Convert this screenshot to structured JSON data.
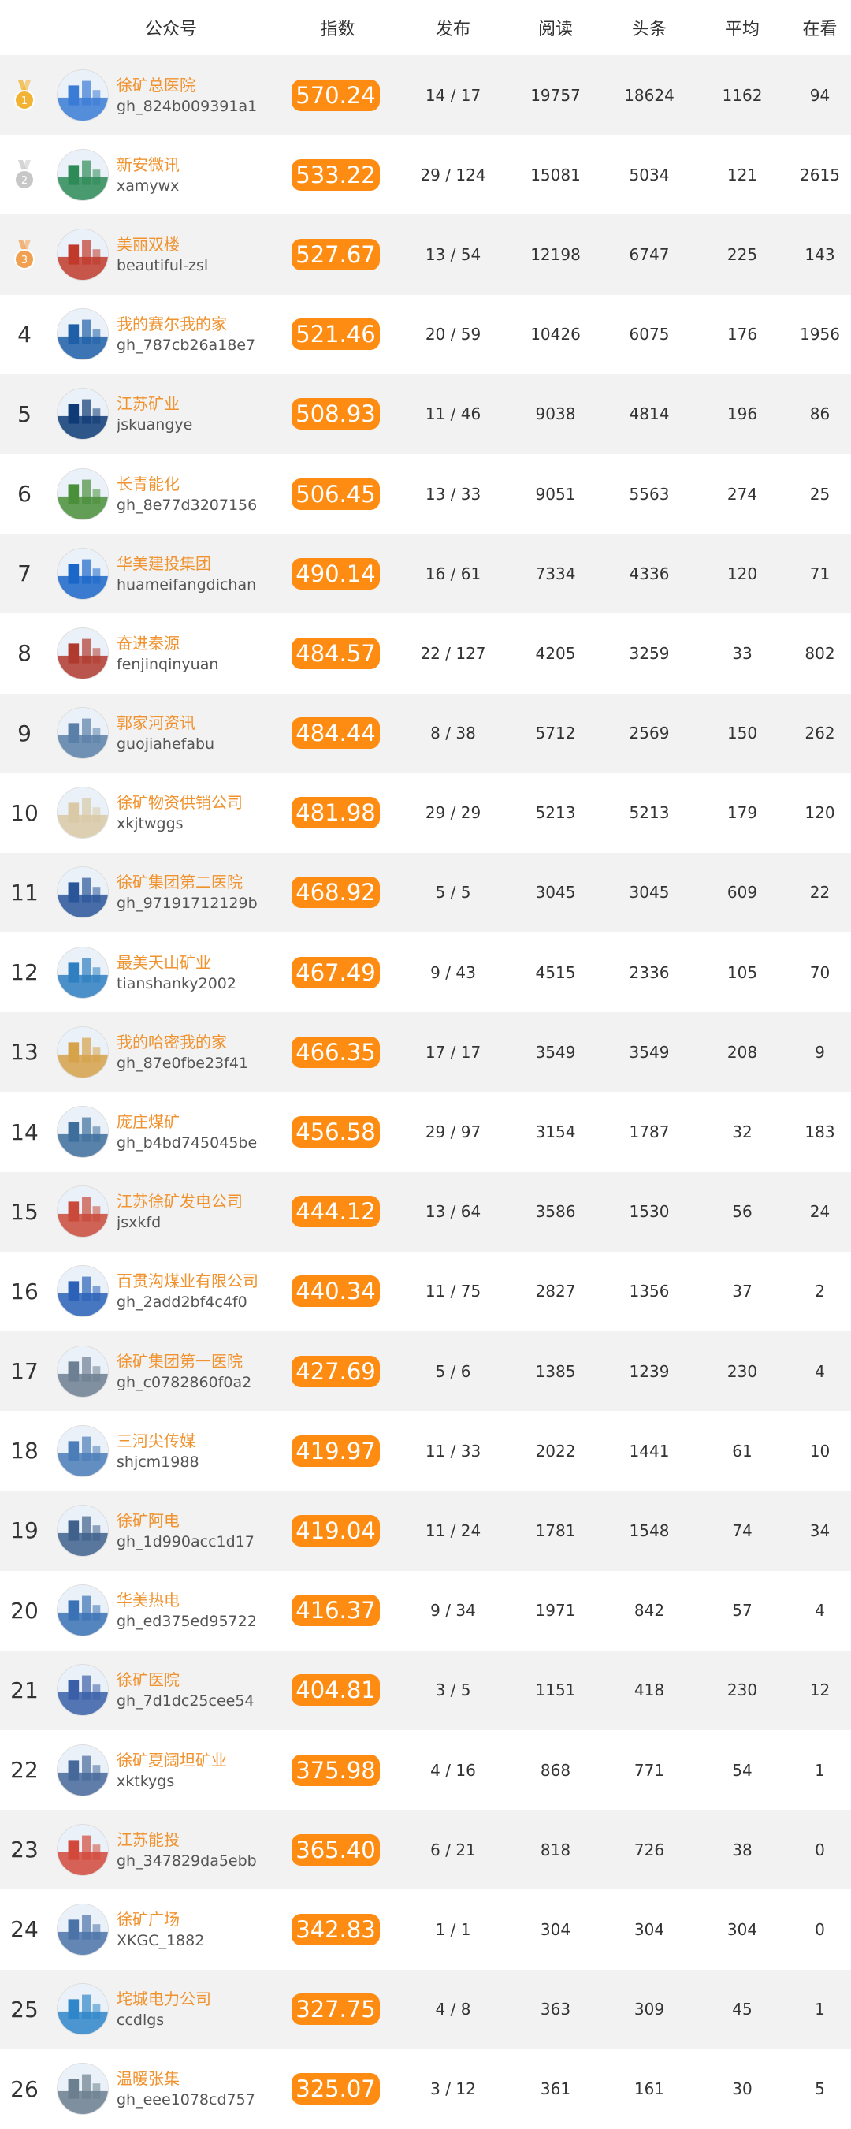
{
  "header": {
    "account": "公众号",
    "index": "指数",
    "publish": "发布",
    "read": "阅读",
    "headline": "头条",
    "average": "平均",
    "watching": "在看"
  },
  "colors": {
    "accent": "#ff8c12",
    "name_text": "#f0922e",
    "gold": "#f2b233",
    "silver": "#c7c7c7",
    "bronze": "#f0a050",
    "row_alt": "#f2f2f2"
  },
  "rows": [
    {
      "rank": "1",
      "medal": "gold",
      "name": "徐矿总医院",
      "id": "gh_824b009391a1",
      "score": "570.24",
      "publish": "14 / 17",
      "read": "19757",
      "headline": "18624",
      "average": "1162",
      "watching": "94"
    },
    {
      "rank": "2",
      "medal": "silver",
      "name": "新安微讯",
      "id": "xamywx",
      "score": "533.22",
      "publish": "29 / 124",
      "read": "15081",
      "headline": "5034",
      "average": "121",
      "watching": "2615"
    },
    {
      "rank": "3",
      "medal": "bronze",
      "name": "美丽双楼",
      "id": "beautiful-zsl",
      "score": "527.67",
      "publish": "13 / 54",
      "read": "12198",
      "headline": "6747",
      "average": "225",
      "watching": "143"
    },
    {
      "rank": "4",
      "name": "我的赛尔我的家",
      "id": "gh_787cb26a18e7",
      "score": "521.46",
      "publish": "20 / 59",
      "read": "10426",
      "headline": "6075",
      "average": "176",
      "watching": "1956"
    },
    {
      "rank": "5",
      "name": "江苏矿业",
      "id": "jskuangye",
      "score": "508.93",
      "publish": "11 / 46",
      "read": "9038",
      "headline": "4814",
      "average": "196",
      "watching": "86"
    },
    {
      "rank": "6",
      "name": "长青能化",
      "id": "gh_8e77d3207156",
      "score": "506.45",
      "publish": "13 / 33",
      "read": "9051",
      "headline": "5563",
      "average": "274",
      "watching": "25"
    },
    {
      "rank": "7",
      "name": "华美建投集团",
      "id": "huameifangdichan",
      "score": "490.14",
      "publish": "16 / 61",
      "read": "7334",
      "headline": "4336",
      "average": "120",
      "watching": "71"
    },
    {
      "rank": "8",
      "name": "奋进秦源",
      "id": "fenjinqinyuan",
      "score": "484.57",
      "publish": "22 / 127",
      "read": "4205",
      "headline": "3259",
      "average": "33",
      "watching": "802"
    },
    {
      "rank": "9",
      "name": "郭家河资讯",
      "id": "guojiahefabu",
      "score": "484.44",
      "publish": "8 / 38",
      "read": "5712",
      "headline": "2569",
      "average": "150",
      "watching": "262"
    },
    {
      "rank": "10",
      "name": "徐矿物资供销公司",
      "id": "xkjtwggs",
      "score": "481.98",
      "publish": "29 / 29",
      "read": "5213",
      "headline": "5213",
      "average": "179",
      "watching": "120"
    },
    {
      "rank": "11",
      "name": "徐矿集团第二医院",
      "id": "gh_97191712129b",
      "score": "468.92",
      "publish": "5 / 5",
      "read": "3045",
      "headline": "3045",
      "average": "609",
      "watching": "22"
    },
    {
      "rank": "12",
      "name": "最美天山矿业",
      "id": "tianshanky2002",
      "score": "467.49",
      "publish": "9 / 43",
      "read": "4515",
      "headline": "2336",
      "average": "105",
      "watching": "70"
    },
    {
      "rank": "13",
      "name": "我的哈密我的家",
      "id": "gh_87e0fbe23f41",
      "score": "466.35",
      "publish": "17 / 17",
      "read": "3549",
      "headline": "3549",
      "average": "208",
      "watching": "9"
    },
    {
      "rank": "14",
      "name": "庞庄煤矿",
      "id": "gh_b4bd745045be",
      "score": "456.58",
      "publish": "29 / 97",
      "read": "3154",
      "headline": "1787",
      "average": "32",
      "watching": "183"
    },
    {
      "rank": "15",
      "name": "江苏徐矿发电公司",
      "id": "jsxkfd",
      "score": "444.12",
      "publish": "13 / 64",
      "read": "3586",
      "headline": "1530",
      "average": "56",
      "watching": "24"
    },
    {
      "rank": "16",
      "name": "百贯沟煤业有限公司",
      "id": "gh_2add2bf4c4f0",
      "score": "440.34",
      "publish": "11 / 75",
      "read": "2827",
      "headline": "1356",
      "average": "37",
      "watching": "2"
    },
    {
      "rank": "17",
      "name": "徐矿集团第一医院",
      "id": "gh_c0782860f0a2",
      "score": "427.69",
      "publish": "5 / 6",
      "read": "1385",
      "headline": "1239",
      "average": "230",
      "watching": "4"
    },
    {
      "rank": "18",
      "name": "三河尖传媒",
      "id": "shjcm1988",
      "score": "419.97",
      "publish": "11 / 33",
      "read": "2022",
      "headline": "1441",
      "average": "61",
      "watching": "10"
    },
    {
      "rank": "19",
      "name": "徐矿阿电",
      "id": "gh_1d990acc1d17",
      "score": "419.04",
      "publish": "11 / 24",
      "read": "1781",
      "headline": "1548",
      "average": "74",
      "watching": "34"
    },
    {
      "rank": "20",
      "name": "华美热电",
      "id": "gh_ed375ed95722",
      "score": "416.37",
      "publish": "9 / 34",
      "read": "1971",
      "headline": "842",
      "average": "57",
      "watching": "4"
    },
    {
      "rank": "21",
      "name": "徐矿医院",
      "id": "gh_7d1dc25cee54",
      "score": "404.81",
      "publish": "3 / 5",
      "read": "1151",
      "headline": "418",
      "average": "230",
      "watching": "12"
    },
    {
      "rank": "22",
      "name": "徐矿夏阔坦矿业",
      "id": "xktkygs",
      "score": "375.98",
      "publish": "4 / 16",
      "read": "868",
      "headline": "771",
      "average": "54",
      "watching": "1"
    },
    {
      "rank": "23",
      "name": "江苏能投",
      "id": "gh_347829da5ebb",
      "score": "365.40",
      "publish": "6 / 21",
      "read": "818",
      "headline": "726",
      "average": "38",
      "watching": "0"
    },
    {
      "rank": "24",
      "name": "徐矿广场",
      "id": "XKGC_1882",
      "score": "342.83",
      "publish": "1 / 1",
      "read": "304",
      "headline": "304",
      "average": "304",
      "watching": "0"
    },
    {
      "rank": "25",
      "name": "垞城电力公司",
      "id": "ccdlgs",
      "score": "327.75",
      "publish": "4 / 8",
      "read": "363",
      "headline": "309",
      "average": "45",
      "watching": "1"
    },
    {
      "rank": "26",
      "name": "温暖张集",
      "id": "gh_eee1078cd757",
      "score": "325.07",
      "publish": "3 / 12",
      "read": "361",
      "headline": "161",
      "average": "30",
      "watching": "5"
    }
  ]
}
